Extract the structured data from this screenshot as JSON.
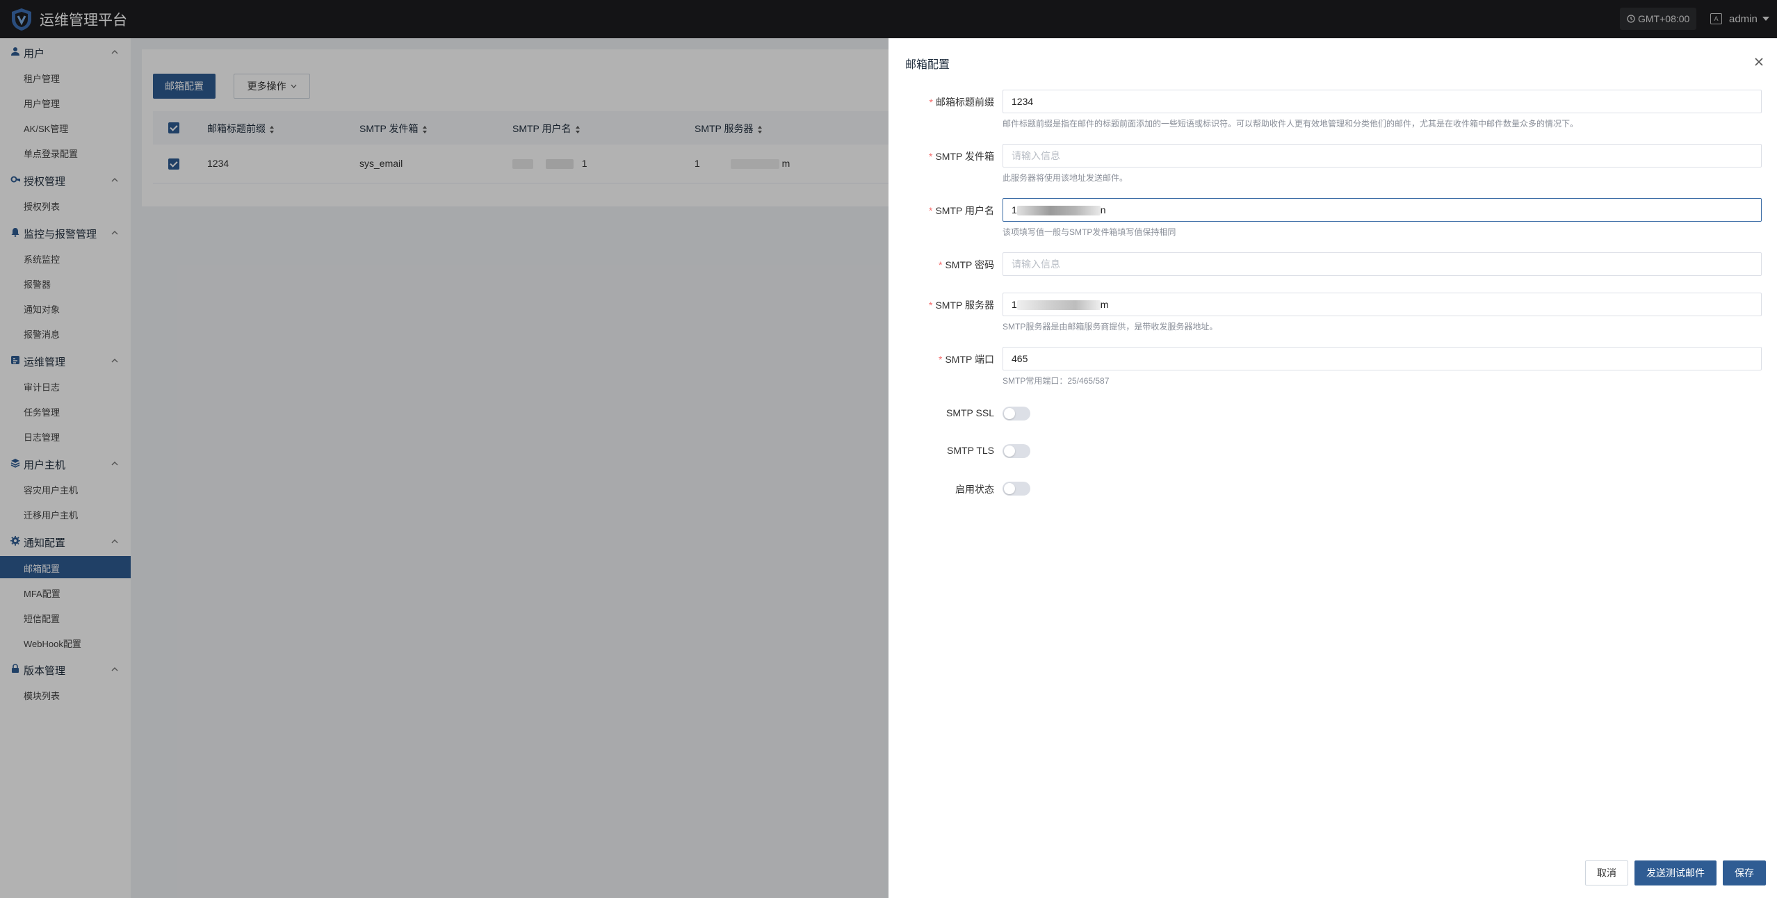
{
  "app": {
    "title": "运维管理平台"
  },
  "topbar": {
    "timezone": "GMT+08:00",
    "lang_icon_text": "A",
    "user": "admin"
  },
  "sidebar": {
    "groups": [
      {
        "label": "用户",
        "icon": "user-icon",
        "items": [
          "租户管理",
          "用户管理",
          "AK/SK管理",
          "单点登录配置"
        ]
      },
      {
        "label": "授权管理",
        "icon": "key-icon",
        "items": [
          "授权列表"
        ]
      },
      {
        "label": "监控与报警管理",
        "icon": "bell-icon",
        "items": [
          "系统监控",
          "报警器",
          "通知对象",
          "报警消息"
        ]
      },
      {
        "label": "运维管理",
        "icon": "ops-icon",
        "items": [
          "审计日志",
          "任务管理",
          "日志管理"
        ]
      },
      {
        "label": "用户主机",
        "icon": "layers-icon",
        "items": [
          "容灾用户主机",
          "迁移用户主机"
        ]
      },
      {
        "label": "通知配置",
        "icon": "gear-icon",
        "items": [
          "邮箱配置",
          "MFA配置",
          "短信配置",
          "WebHook配置"
        ]
      },
      {
        "label": "版本管理",
        "icon": "lock-icon",
        "items": [
          "模块列表"
        ]
      }
    ],
    "active_item": "邮箱配置"
  },
  "main": {
    "toolbar": {
      "primary": "邮箱配置",
      "more": "更多操作"
    },
    "table": {
      "columns": [
        "邮箱标题前缀",
        "SMTP 发件箱",
        "SMTP 用户名",
        "SMTP 服务器"
      ],
      "rows": [
        {
          "prefix": "1234",
          "sender": "sys_email",
          "username_tail": "1",
          "server_head": "1",
          "server_tail": "m"
        }
      ]
    }
  },
  "drawer": {
    "title": "邮箱配置",
    "fields": [
      {
        "label": "邮箱标题前缀",
        "required": true,
        "value": "1234",
        "placeholder": "",
        "hint": "邮件标题前缀是指在邮件的标题前面添加的一些短语或标识符。可以帮助收件人更有效地管理和分类他们的邮件，尤其是在收件箱中邮件数量众多的情况下。"
      },
      {
        "label": "SMTP 发件箱",
        "required": true,
        "value": "",
        "placeholder": "请输入信息",
        "hint": "此服务器将使用该地址发送邮件。"
      },
      {
        "label": "SMTP 用户名",
        "required": true,
        "value_head": "1",
        "value_tail": "n",
        "placeholder": "",
        "hint": "该项填写值一般与SMTP发件箱填写值保持相同"
      },
      {
        "label": "SMTP 密码",
        "required": true,
        "value": "",
        "placeholder": "请输入信息",
        "hint": ""
      },
      {
        "label": "SMTP 服务器",
        "required": true,
        "value_head": "1",
        "value_tail": "m",
        "placeholder": "",
        "hint": "SMTP服务器是由邮箱服务商提供，是带收发服务器地址。"
      },
      {
        "label": "SMTP 端口",
        "required": true,
        "value": "465",
        "placeholder": "",
        "hint": "SMTP常用端口：25/465/587"
      }
    ],
    "switches": [
      {
        "label": "SMTP SSL",
        "on": false
      },
      {
        "label": "SMTP TLS",
        "on": false
      },
      {
        "label": "启用状态",
        "on": false
      }
    ],
    "buttons": {
      "cancel": "取消",
      "test": "发送测试邮件",
      "save": "保存"
    }
  },
  "colors": {
    "primary": "#2f5c93",
    "topbar": "#1d1e20",
    "required": "#f56c6c",
    "mask": "rgba(0,0,0,0.30)"
  }
}
